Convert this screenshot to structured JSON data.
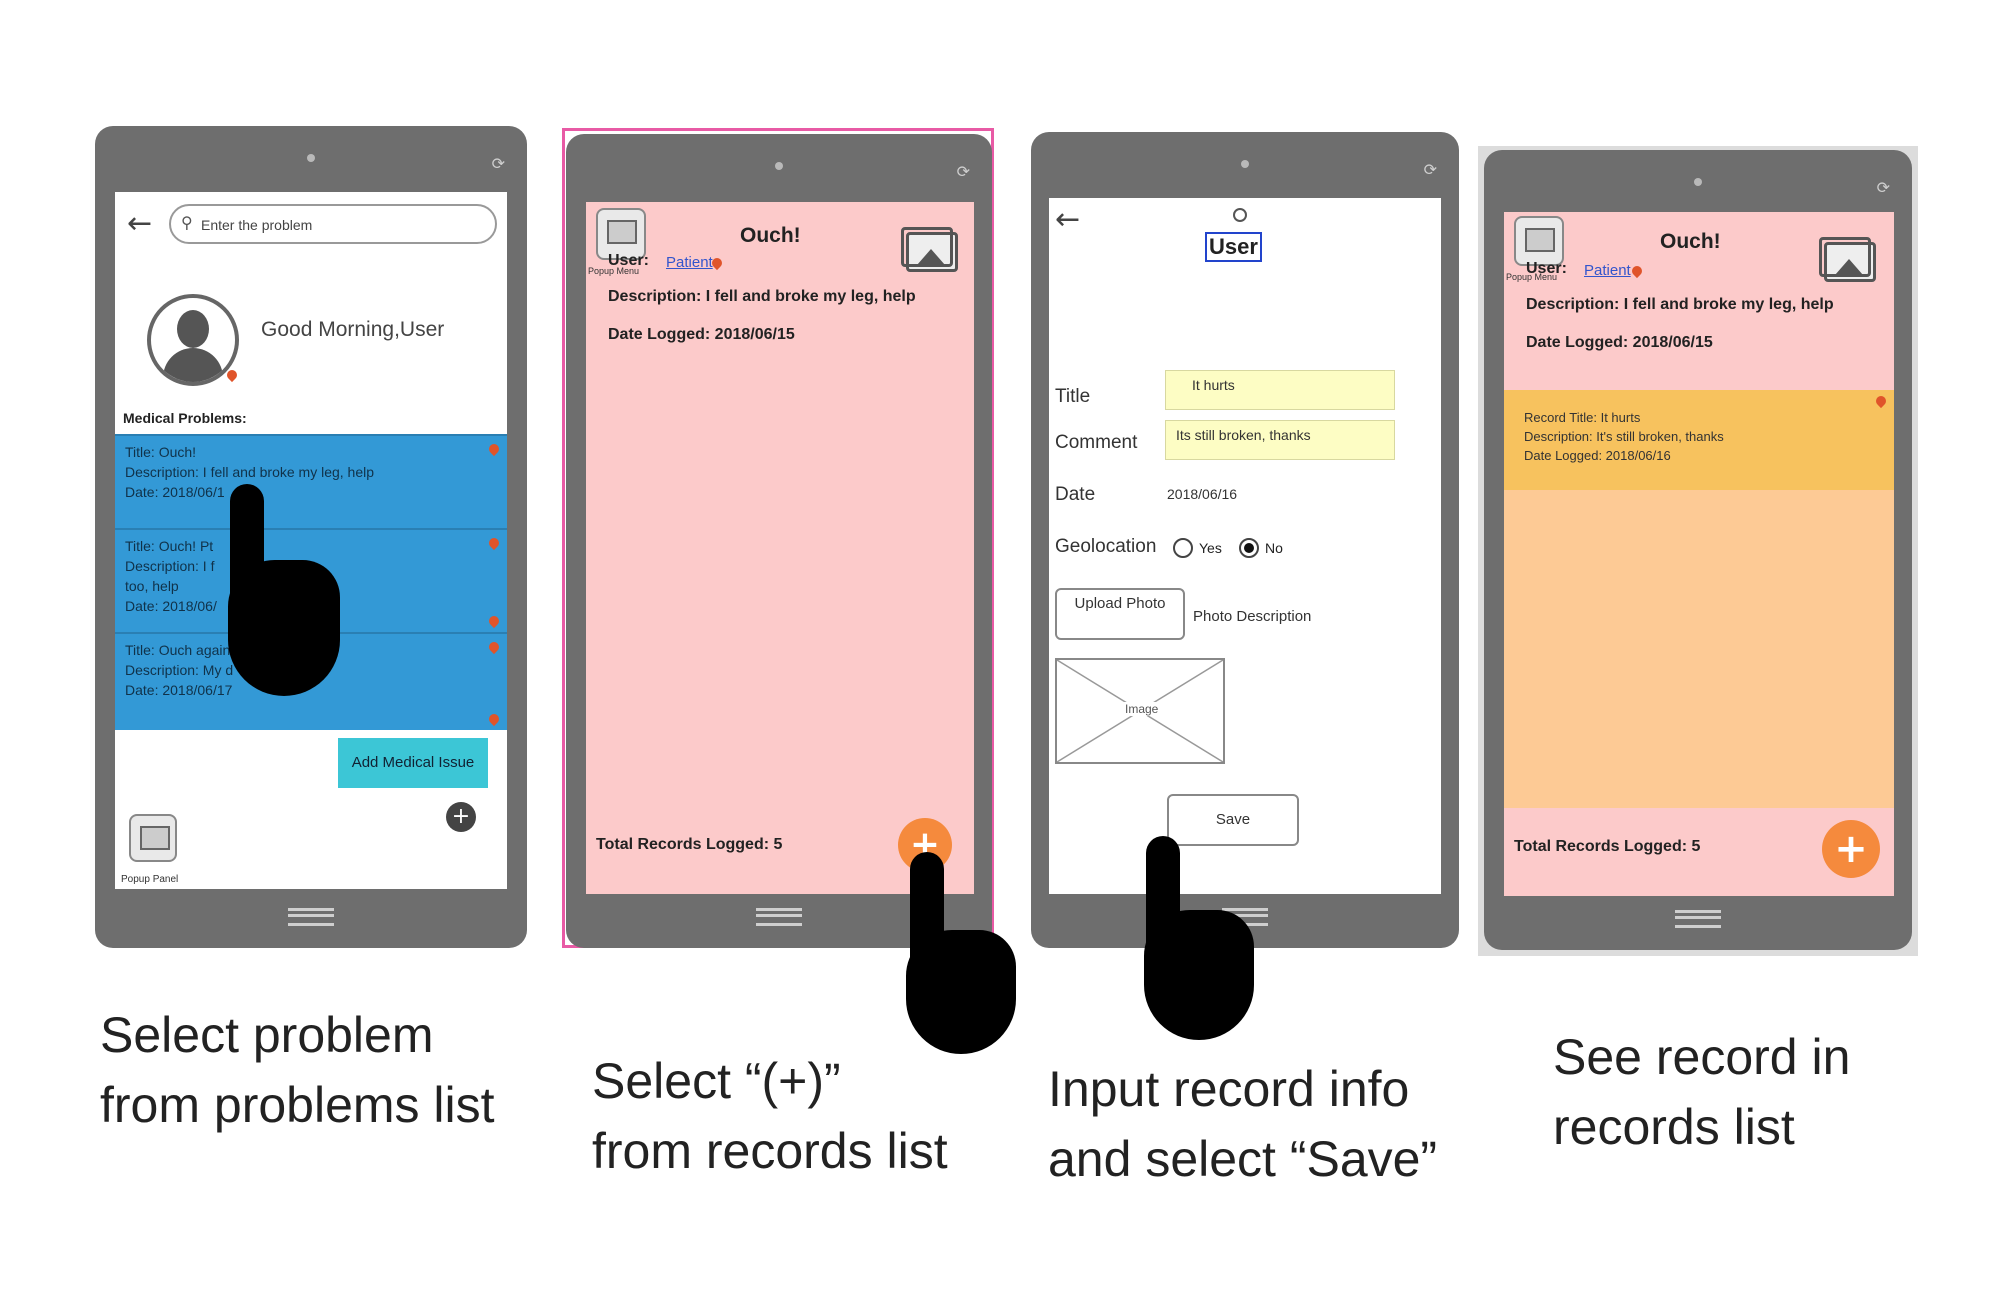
{
  "screen1": {
    "search_placeholder": "Enter the problem",
    "greeting": "Good Morning,User",
    "section_label": "Medical Problems:",
    "problems": [
      {
        "title": "Title: Ouch!",
        "description": "Description: I fell and broke my leg, help",
        "date": "Date: 2018/06/1"
      },
      {
        "title": "Title: Ouch! Pt",
        "description": "Description: I f       my other leg",
        "extra": "too, help",
        "date": "Date: 2018/06/"
      },
      {
        "title": "Title: Ouch again",
        "description": "Description: My d",
        "date": "Date: 2018/06/17"
      }
    ],
    "add_button": "Add Medical Issue",
    "popup_panel_label": "Popup Panel",
    "caption_line1": "Select problem",
    "caption_line2": "from problems list",
    "icons": [
      "back-arrow-icon",
      "search-icon",
      "avatar-icon",
      "add-icon",
      "popup-panel-icon"
    ]
  },
  "screen2": {
    "title": "Ouch!",
    "user_label": "User:",
    "user_link": "Patient",
    "popup_menu_label": "Popup Menu",
    "description": "Description: I fell and broke my leg, help",
    "date_logged": "Date Logged: 2018/06/15",
    "total": "Total Records Logged: 5",
    "caption_line1": "Select “(+)”",
    "caption_line2": "from records list",
    "colors": {
      "background": "#fccaca",
      "accent": "#f58a3d"
    }
  },
  "screen3": {
    "user_title": "User",
    "title_label": "Title",
    "title_value": "It hurts",
    "comment_label": "Comment",
    "comment_value": "Its still broken, thanks",
    "date_label": "Date",
    "date_value": "2018/06/16",
    "geo_label": "Geolocation",
    "geo_yes": "Yes",
    "geo_no": "No",
    "geo_selected": "No",
    "upload_button": "Upload Photo",
    "photo_description": "Photo Description",
    "image_placeholder": "Image",
    "save_button": "Save",
    "caption_line1": "Input record info",
    "caption_line2": "and select “Save”"
  },
  "screen4": {
    "title": "Ouch!",
    "user_label": "User:",
    "user_link": "Patient",
    "popup_menu_label": "Popup Menu",
    "description": "Description: I fell and broke my leg, help",
    "date_logged": "Date Logged: 2018/06/15",
    "record": {
      "title": "Record Title: It hurts",
      "description": "Description: It's still broken, thanks",
      "date": "Date Logged: 2018/06/16"
    },
    "total": "Total Records Logged: 5",
    "caption_line1": "See record in",
    "caption_line2": "records list",
    "colors": {
      "record_bg": "#f7c25e",
      "list_bg": "#fdca95"
    }
  }
}
